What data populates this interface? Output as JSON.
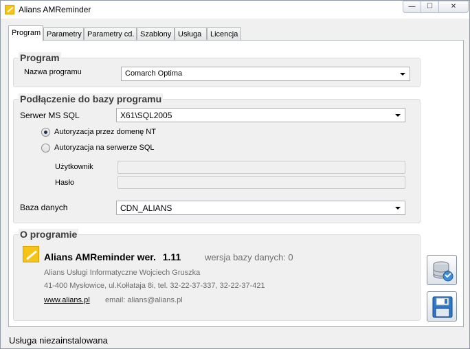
{
  "window": {
    "title": "Alians AMReminder",
    "controls": {
      "minimize": "—",
      "maximize": "☐",
      "close": "✕"
    }
  },
  "tabs": [
    {
      "label": "Program",
      "active": true
    },
    {
      "label": "Parametry",
      "active": false
    },
    {
      "label": "Parametry cd.",
      "active": false
    },
    {
      "label": "Szablony",
      "active": false
    },
    {
      "label": "Usługa",
      "active": false
    },
    {
      "label": "Licencja",
      "active": false
    }
  ],
  "program_group": {
    "title": "Program",
    "name_label": "Nazwa programu",
    "name_value": "Comarch Optima"
  },
  "db_group": {
    "title": "Podłączenie do bazy programu",
    "server_label": "Serwer MS SQL",
    "server_value": "X61\\SQL2005",
    "auth_nt_label": "Autoryzacja przez domenę NT",
    "auth_sql_label": "Autoryzacja na serwerze SQL",
    "user_label": "Użytkownik",
    "user_value": "",
    "password_label": "Hasło",
    "password_value": "",
    "database_label": "Baza danych",
    "database_value": "CDN_ALIANS"
  },
  "about_group": {
    "title": "O programie",
    "product": "Alians AMReminder wer.",
    "version": "1.11",
    "db_version": "wersja bazy danych: 0",
    "company": "Alians Usługi Informatyczne Wojciech Gruszka",
    "address": "41-400 Mysłowice, ul.Kołłataja 8i, tel. 32-22-37-337, 32-22-37-421",
    "website": "www.alians.pl",
    "email": "email: alians@alians.pl"
  },
  "side_buttons": {
    "db_config_icon": "database-config-icon",
    "save_icon": "floppy-save-icon"
  },
  "status": {
    "text": "Usługa niezainstalowana"
  }
}
